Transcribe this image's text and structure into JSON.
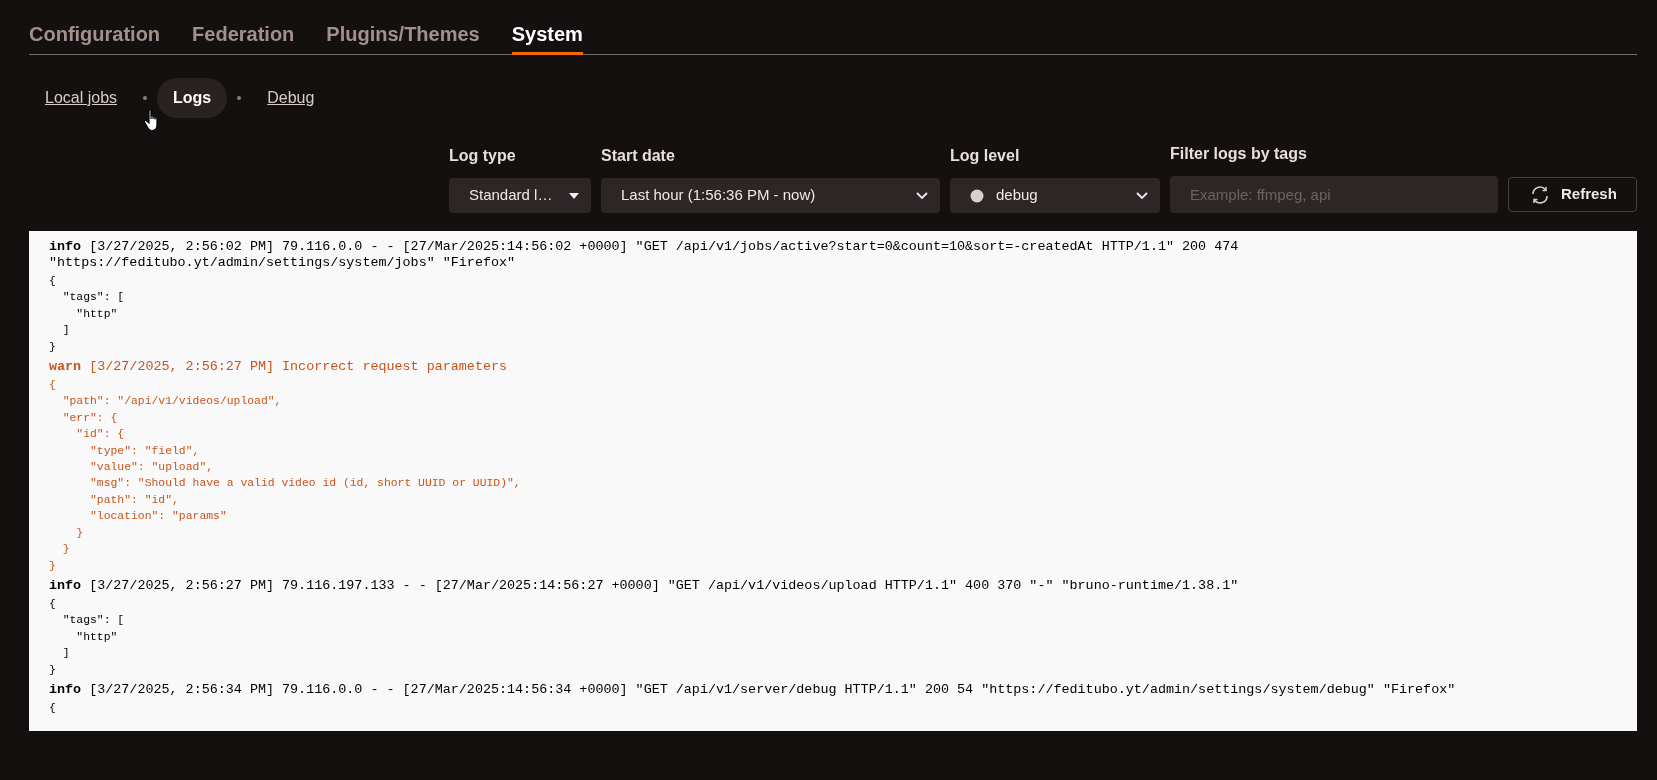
{
  "tabs": [
    {
      "label": "Configuration",
      "selected": false
    },
    {
      "label": "Federation",
      "selected": false
    },
    {
      "label": "Plugins/Themes",
      "selected": false
    },
    {
      "label": "System",
      "selected": true
    }
  ],
  "subnav": [
    {
      "label": "Local jobs",
      "selected": false
    },
    {
      "label": "Logs",
      "selected": true
    },
    {
      "label": "Debug",
      "selected": false
    }
  ],
  "filters": {
    "log_type": {
      "label": "Log type",
      "value": "Standard l…"
    },
    "start_date": {
      "label": "Start date",
      "value": "Last hour (1:56:36 PM - now)"
    },
    "log_level": {
      "label": "Log level",
      "value": "debug"
    },
    "tags": {
      "label": "Filter logs by tags",
      "placeholder": "Example: ffmpeg, api"
    },
    "refresh_button": "Refresh"
  },
  "logs": [
    {
      "kind": "info",
      "label": "info",
      "message": "[3/27/2025, 2:56:02 PM] 79.116.0.0 - - [27/Mar/2025:14:56:02 +0000] \"GET /api/v1/jobs/active?start=0&count=10&sort=-createdAt HTTP/1.1\" 200 474 \"https://feditubo.yt/admin/settings/system/jobs\" \"Firefox\"",
      "body": [
        "{",
        "  \"tags\": [",
        "    \"http\"",
        "  ]",
        "}"
      ]
    },
    {
      "kind": "warn",
      "label": "warn",
      "message": "[3/27/2025, 2:56:27 PM] Incorrect request parameters",
      "body": [
        "{",
        "  \"path\": \"/api/v1/videos/upload\",",
        "  \"err\": {",
        "    \"id\": {",
        "      \"type\": \"field\",",
        "      \"value\": \"upload\",",
        "      \"msg\": \"Should have a valid video id (id, short UUID or UUID)\",",
        "      \"path\": \"id\",",
        "      \"location\": \"params\"",
        "    }",
        "  }",
        "}"
      ]
    },
    {
      "kind": "info",
      "label": "info",
      "message": "[3/27/2025, 2:56:27 PM] 79.116.197.133 - - [27/Mar/2025:14:56:27 +0000] \"GET /api/v1/videos/upload HTTP/1.1\" 400 370 \"-\" \"bruno-runtime/1.38.1\"",
      "body": [
        "{",
        "  \"tags\": [",
        "    \"http\"",
        "  ]",
        "}"
      ]
    },
    {
      "kind": "info",
      "label": "info",
      "message": "[3/27/2025, 2:56:34 PM] 79.116.0.0 - - [27/Mar/2025:14:56:34 +0000] \"GET /api/v1/server/debug HTTP/1.1\" 200 54 \"https://feditubo.yt/admin/settings/system/debug\" \"Firefox\"",
      "body": [
        "{"
      ]
    }
  ]
}
